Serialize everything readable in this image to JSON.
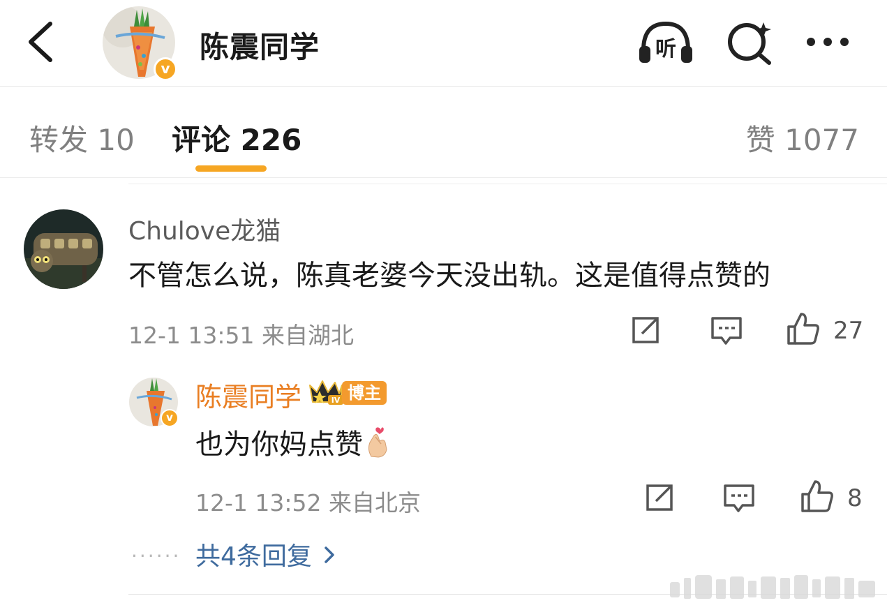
{
  "header": {
    "back_icon": "chevron-left-icon",
    "account_name": "陈震同学",
    "listen_icon_text": "听",
    "verified_mark": "v",
    "colors": {
      "verified": "#f6a623",
      "text": "#1a1a1a"
    }
  },
  "tabs": {
    "repost": "转发 10",
    "comment": "评论 226",
    "like": "赞 1077",
    "active_indicator_color": "#f6a623"
  },
  "comment": {
    "author": "Chulove龙猫",
    "text": "不管怎么说，陈真老婆今天没出轨。这是值得点赞的",
    "meta": "12-1 13:51 来自湖北",
    "like_count": "27",
    "reply": {
      "author": "陈震同学",
      "crown_level": "IV",
      "badge": "博主",
      "text": "也为你妈点赞",
      "meta": "12-1 13:52 来自北京",
      "like_count": "8",
      "verified_mark": "v"
    },
    "more_replies": "共4条回复"
  },
  "colors": {
    "accent": "#f6a623",
    "author_highlight": "#e97e22",
    "link": "#3f6b9e",
    "meta": "#8c8c8c"
  }
}
